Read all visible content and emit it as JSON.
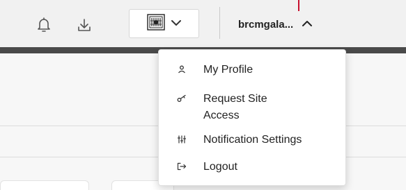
{
  "header": {
    "user_menu": {
      "name": "brcmgala...",
      "expanded": true
    },
    "logo_select_icon": "building-logo-icon",
    "accent_color": "#c8102e",
    "stripe_color": "#4a4a4a"
  },
  "user_dropdown": {
    "items": [
      {
        "label": "My Profile",
        "icon": "person-icon"
      },
      {
        "label": "Request Site\nAccess",
        "icon": "key-icon"
      },
      {
        "label": "Notification Settings",
        "icon": "sliders-icon"
      },
      {
        "label": "Logout",
        "icon": "logout-icon"
      }
    ]
  }
}
